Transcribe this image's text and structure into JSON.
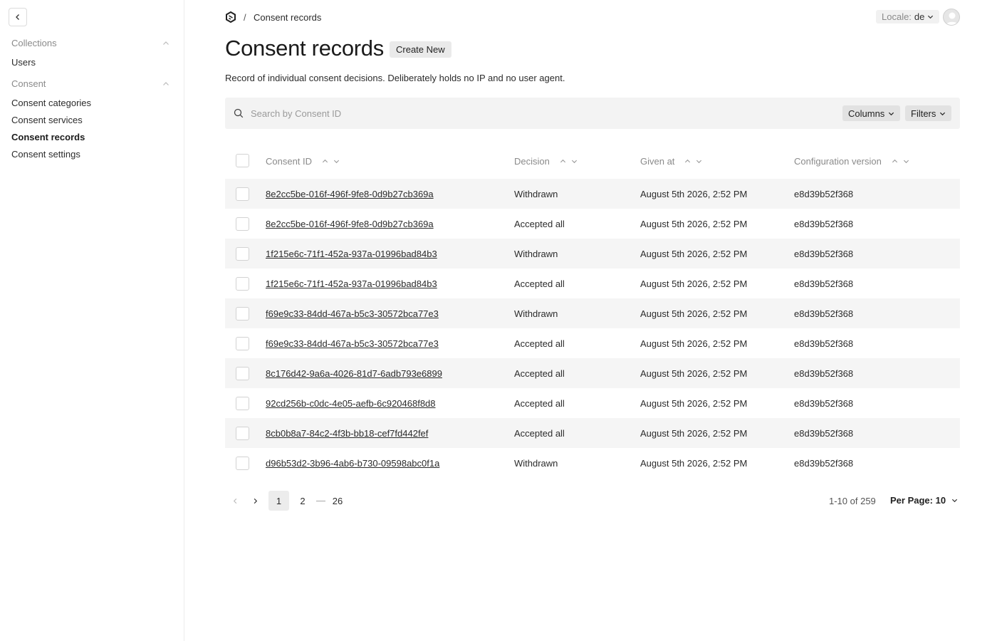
{
  "sidebar": {
    "groups": [
      {
        "label": "Collections",
        "items": [
          {
            "label": "Users"
          }
        ]
      },
      {
        "label": "Consent",
        "items": [
          {
            "label": "Consent categories"
          },
          {
            "label": "Consent services"
          },
          {
            "label": "Consent records",
            "active": true
          },
          {
            "label": "Consent settings"
          }
        ]
      }
    ]
  },
  "header": {
    "breadcrumb_separator": "/",
    "breadcrumb_current": "Consent records",
    "locale_label": "Locale:",
    "locale_value": "de"
  },
  "page": {
    "title": "Consent records",
    "create_label": "Create New",
    "description": "Record of individual consent decisions. Deliberately holds no IP and no user agent."
  },
  "search": {
    "placeholder": "Search by Consent ID",
    "columns_label": "Columns",
    "filters_label": "Filters"
  },
  "table": {
    "columns": [
      "Consent ID",
      "Decision",
      "Given at",
      "Configuration version"
    ],
    "rows": [
      {
        "id": "8e2cc5be-016f-496f-9fe8-0d9b27cb369a",
        "decision": "Withdrawn",
        "given_at": "August 5th 2026, 2:52 PM",
        "version": "e8d39b52f368"
      },
      {
        "id": "8e2cc5be-016f-496f-9fe8-0d9b27cb369a",
        "decision": "Accepted all",
        "given_at": "August 5th 2026, 2:52 PM",
        "version": "e8d39b52f368"
      },
      {
        "id": "1f215e6c-71f1-452a-937a-01996bad84b3",
        "decision": "Withdrawn",
        "given_at": "August 5th 2026, 2:52 PM",
        "version": "e8d39b52f368"
      },
      {
        "id": "1f215e6c-71f1-452a-937a-01996bad84b3",
        "decision": "Accepted all",
        "given_at": "August 5th 2026, 2:52 PM",
        "version": "e8d39b52f368"
      },
      {
        "id": "f69e9c33-84dd-467a-b5c3-30572bca77e3",
        "decision": "Withdrawn",
        "given_at": "August 5th 2026, 2:52 PM",
        "version": "e8d39b52f368"
      },
      {
        "id": "f69e9c33-84dd-467a-b5c3-30572bca77e3",
        "decision": "Accepted all",
        "given_at": "August 5th 2026, 2:52 PM",
        "version": "e8d39b52f368"
      },
      {
        "id": "8c176d42-9a6a-4026-81d7-6adb793e6899",
        "decision": "Accepted all",
        "given_at": "August 5th 2026, 2:52 PM",
        "version": "e8d39b52f368"
      },
      {
        "id": "92cd256b-c0dc-4e05-aefb-6c920468f8d8",
        "decision": "Accepted all",
        "given_at": "August 5th 2026, 2:52 PM",
        "version": "e8d39b52f368"
      },
      {
        "id": "8cb0b8a7-84c2-4f3b-bb18-cef7fd442fef",
        "decision": "Accepted all",
        "given_at": "August 5th 2026, 2:52 PM",
        "version": "e8d39b52f368"
      },
      {
        "id": "d96b53d2-3b96-4ab6-b730-09598abc0f1a",
        "decision": "Withdrawn",
        "given_at": "August 5th 2026, 2:52 PM",
        "version": "e8d39b52f368"
      }
    ]
  },
  "pagination": {
    "pages": [
      "1",
      "2",
      "—",
      "26"
    ],
    "current": "1",
    "count_text": "1-10 of 259",
    "per_page_label": "Per Page:",
    "per_page_value": "10"
  },
  "icons": {
    "back": "chevron-left-icon",
    "collapse": "chevron-up-icon",
    "logo": "app-logo-icon",
    "search": "search-icon",
    "dropdown": "chevron-down-icon",
    "prev": "chevron-left-icon",
    "next": "chevron-right-icon",
    "avatar": "user-avatar-icon"
  }
}
